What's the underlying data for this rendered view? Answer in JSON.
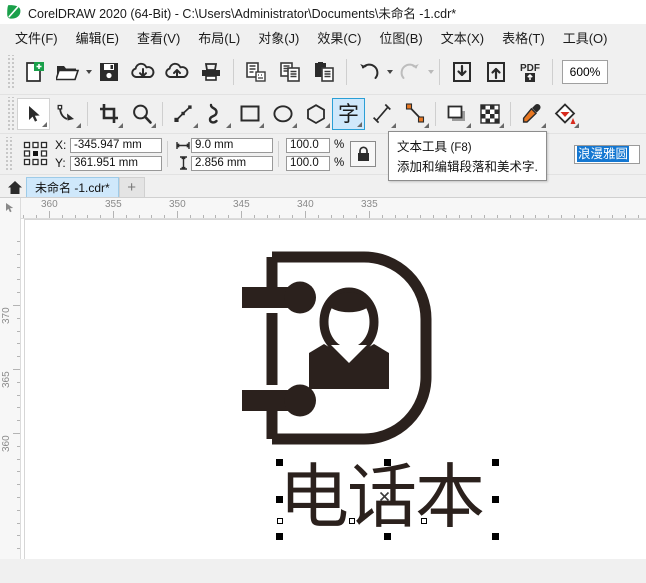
{
  "window": {
    "title": "CorelDRAW 2020 (64-Bit) - C:\\Users\\Administrator\\Documents\\未命名 -1.cdr*",
    "logo_icon": "coreldraw-balloon-icon"
  },
  "menubar": {
    "items": [
      {
        "label": "文件(F)",
        "name": "menu-file"
      },
      {
        "label": "编辑(E)",
        "name": "menu-edit"
      },
      {
        "label": "查看(V)",
        "name": "menu-view"
      },
      {
        "label": "布局(L)",
        "name": "menu-layout"
      },
      {
        "label": "对象(J)",
        "name": "menu-object"
      },
      {
        "label": "效果(C)",
        "name": "menu-effects"
      },
      {
        "label": "位图(B)",
        "name": "menu-bitmaps"
      },
      {
        "label": "文本(X)",
        "name": "menu-text"
      },
      {
        "label": "表格(T)",
        "name": "menu-table"
      },
      {
        "label": "工具(O)",
        "name": "menu-tools"
      }
    ]
  },
  "toolbar": {
    "buttons": [
      {
        "name": "new-document-button",
        "icon": "new-document-icon"
      },
      {
        "name": "open-document-button",
        "icon": "open-folder-icon"
      },
      {
        "name": "save-document-button",
        "icon": "floppy-save-icon"
      },
      {
        "name": "download-cloud-button",
        "icon": "cloud-download-icon"
      },
      {
        "name": "upload-cloud-button",
        "icon": "cloud-upload-icon"
      },
      {
        "name": "print-button",
        "icon": "printer-icon"
      },
      {
        "name": "cut-button",
        "icon": "scissors-cut-icon"
      },
      {
        "name": "copy-button",
        "icon": "copy-icon"
      },
      {
        "name": "paste-button",
        "icon": "paste-clipboard-icon"
      },
      {
        "name": "undo-button",
        "icon": "undo-arrow-icon"
      },
      {
        "name": "redo-button",
        "icon": "redo-arrow-icon"
      },
      {
        "name": "import-button",
        "icon": "import-down-arrow-icon"
      },
      {
        "name": "export-button",
        "icon": "export-up-arrow-icon"
      },
      {
        "name": "publish-pdf-button",
        "icon": "pdf-icon"
      }
    ],
    "zoom_level": "600%"
  },
  "toolbox": {
    "tools": [
      {
        "name": "pick-tool",
        "icon": "arrow-pointer-icon",
        "state": "active"
      },
      {
        "name": "shape-tool",
        "icon": "node-edit-icon",
        "state": "normal"
      },
      {
        "name": "crop-tool",
        "icon": "crop-icon",
        "state": "normal"
      },
      {
        "name": "zoom-tool",
        "icon": "magnifier-icon",
        "state": "normal"
      },
      {
        "name": "freehand-tool",
        "icon": "polyline-icon",
        "state": "normal"
      },
      {
        "name": "artistic-media-tool",
        "icon": "brush-stroke-icon",
        "state": "normal"
      },
      {
        "name": "rectangle-tool",
        "icon": "rectangle-icon",
        "state": "normal"
      },
      {
        "name": "ellipse-tool",
        "icon": "ellipse-icon",
        "state": "normal"
      },
      {
        "name": "polygon-tool",
        "icon": "hexagon-icon",
        "state": "normal"
      },
      {
        "name": "text-tool",
        "icon": "text-char-icon",
        "state": "selected"
      },
      {
        "name": "parallel-dimension-tool",
        "icon": "dimension-line-icon",
        "state": "normal"
      },
      {
        "name": "connector-tool",
        "icon": "connector-icon",
        "state": "normal"
      },
      {
        "name": "drop-shadow-tool",
        "icon": "drop-shadow-icon",
        "state": "normal"
      },
      {
        "name": "transparency-tool",
        "icon": "checkerboard-icon",
        "state": "normal"
      },
      {
        "name": "color-eyedropper-tool",
        "icon": "eyedropper-icon",
        "state": "normal"
      },
      {
        "name": "interactive-fill-tool",
        "icon": "fill-bucket-icon",
        "state": "normal"
      }
    ],
    "text_tool_glyph": "字"
  },
  "propertybar": {
    "anchor_icon": "object-anchor-grid-icon",
    "x_label": "X:",
    "y_label": "Y:",
    "x_value": "-345.947 mm",
    "y_value": "361.951 mm",
    "width_icon": "horizontal-size-icon",
    "height_icon": "vertical-size-icon",
    "width_value": "9.0 mm",
    "height_value": "2.856 mm",
    "scale_h": "100.0",
    "scale_v": "100.0",
    "percent_symbol": "%",
    "lock_icon": "lock-ratio-icon",
    "font_name": "浪漫雅圆"
  },
  "tooltip": {
    "title": "文本工具",
    "shortcut": "(F8)",
    "description": "添加和编辑段落和美术字."
  },
  "tabs": {
    "home_icon": "home-icon",
    "document_tab": "未命名 -1.cdr*",
    "add_tab_label": "+"
  },
  "rulers": {
    "horizontal_labels": [
      "360",
      "355",
      "350",
      "345",
      "340",
      "335"
    ],
    "horizontal_positions": [
      119,
      278,
      437,
      596,
      755,
      914
    ],
    "vertical_labels": [
      "370",
      "365",
      "360"
    ],
    "vertical_positions": [
      84,
      243,
      402
    ],
    "unit": "mm"
  },
  "artwork": {
    "title": "电话本",
    "icon_description": "address-book-with-person-icon",
    "stroke_color": "#2b211d",
    "selected": true,
    "selection_handles": 8
  }
}
